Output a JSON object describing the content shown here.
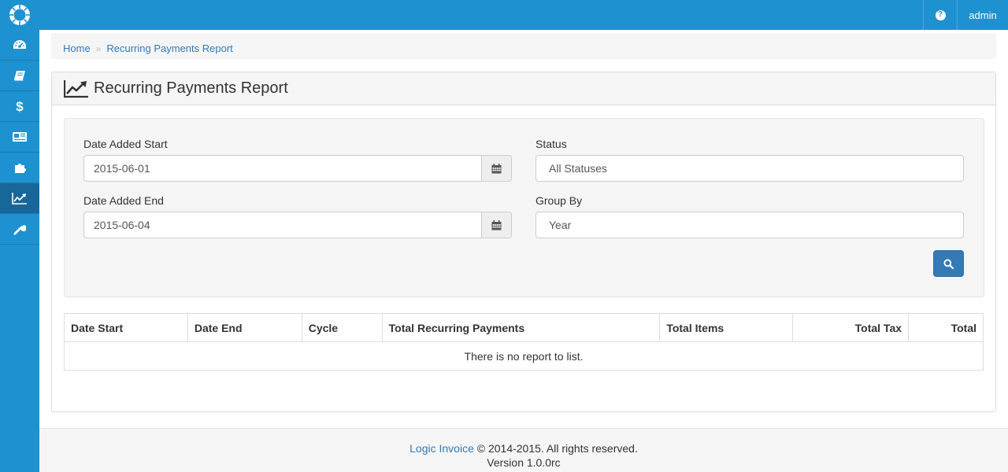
{
  "topbar": {
    "logo_icon": "logo-ring-icon",
    "help_icon": "question-circle-icon",
    "help_glyph": "?",
    "user_label": "admin"
  },
  "sidebar": {
    "items": [
      {
        "icon": "dashboard-icon",
        "active": false
      },
      {
        "icon": "book-icon",
        "active": false
      },
      {
        "icon": "dollar-icon",
        "active": false
      },
      {
        "icon": "newspaper-icon",
        "active": false
      },
      {
        "icon": "puzzle-icon",
        "active": false
      },
      {
        "icon": "line-chart-icon",
        "active": true
      },
      {
        "icon": "wrench-icon",
        "active": false
      }
    ]
  },
  "breadcrumb": {
    "home": "Home",
    "separator": "»",
    "current": "Recurring Payments Report"
  },
  "panel": {
    "title": "Recurring Payments Report",
    "title_icon": "line-chart-icon"
  },
  "filters": {
    "date_start_label": "Date Added Start",
    "date_start_value": "2015-06-01",
    "date_end_label": "Date Added End",
    "date_end_value": "2015-06-04",
    "status_label": "Status",
    "status_value": "All Statuses",
    "group_by_label": "Group By",
    "group_by_value": "Year",
    "calendar_icon": "calendar-icon",
    "search_icon": "search-icon"
  },
  "table": {
    "columns": [
      "Date Start",
      "Date End",
      "Cycle",
      "Total Recurring Payments",
      "Total Items",
      "Total Tax",
      "Total"
    ],
    "empty_message": "There is no report to list."
  },
  "footer": {
    "brand": "Logic Invoice",
    "copyright": "© 2014-2015. All rights reserved.",
    "version": "Version 1.0.0rc"
  },
  "colors": {
    "brand_blue": "#1e91d0",
    "sidebar_active": "#18679a",
    "link": "#337ab7",
    "button_primary": "#337ab7"
  }
}
